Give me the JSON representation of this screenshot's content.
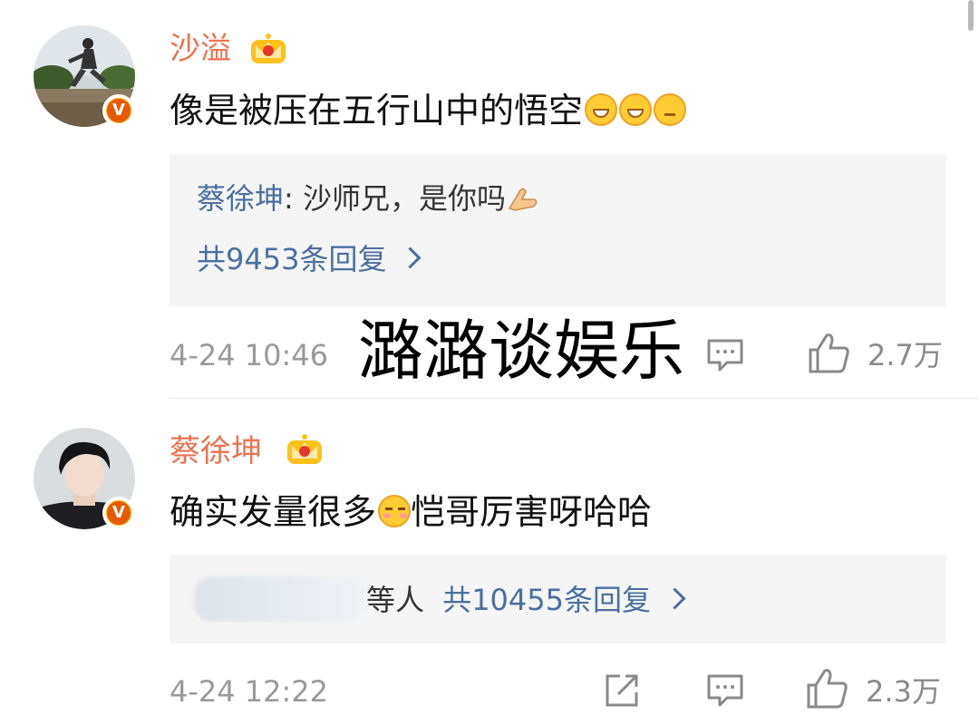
{
  "comments": [
    {
      "author": "沙溢",
      "text": "像是被压在五行山中的悟空",
      "emojis": [
        "grin-emoji",
        "grin-emoji",
        "thinking-emoji"
      ],
      "reply_preview": {
        "author": "蔡徐坤",
        "separator": ": ",
        "text": "沙师兄，是你吗"
      },
      "reply_count": "共9453条回复",
      "time": "4-24 10:46",
      "likes": "2.7万"
    },
    {
      "author": "蔡徐坤",
      "text_a": "确实发量很多",
      "text_b": "恺哥厉害呀哈哈",
      "reply_preview": {
        "suffix": "等人"
      },
      "reply_count": "共10455条回复",
      "time": "4-24 12:22",
      "likes": "2.3万"
    }
  ],
  "watermark": "潞潞谈娱乐",
  "colors": {
    "author": "#eb7350",
    "link": "#4a6fa0",
    "meta": "#9a9a9a",
    "reply_bg": "#f5f5f5"
  }
}
